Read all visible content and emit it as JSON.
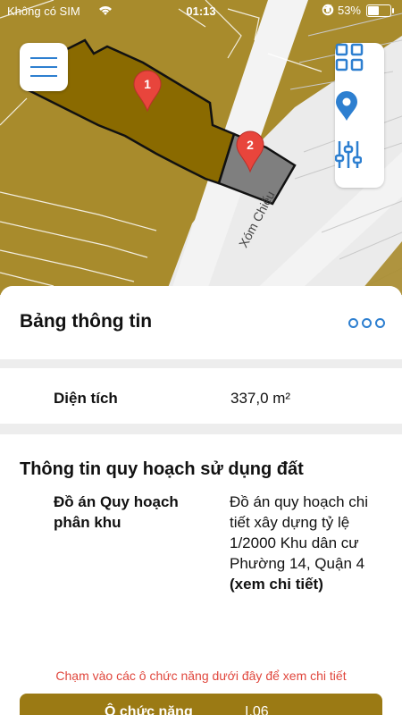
{
  "status_bar": {
    "carrier": "Không có SIM",
    "time": "01:13",
    "battery": "53%",
    "battery_level": 0.53
  },
  "map": {
    "street_name": "Xóm Chiếu",
    "markers": [
      "1",
      "2"
    ],
    "colors": {
      "land_zone": "#a88b2c",
      "selected_parcel": "#8a6a00",
      "adjacent_parcel": "#7f7f7f",
      "road": "#ececec",
      "marker": "#e8453c"
    },
    "controls": [
      "menu-icon",
      "grid-icon",
      "location-pin-icon",
      "sliders-icon"
    ]
  },
  "info_panel": {
    "title": "Bảng thông tin",
    "area": {
      "label": "Diện tích",
      "value": "337,0 m²"
    },
    "planning": {
      "title": "Thông tin quy hoạch sử dụng đất",
      "label": "Đồ án Quy hoạch phân khu",
      "value": "Đồ án quy hoạch chi tiết xây dựng tỷ lệ 1/2000 Khu dân cư Phường 14, Quận 4",
      "link": "(xem chi tiết)"
    },
    "hint": "Chạm vào các ô chức năng dưới đây để xem chi tiết",
    "function_table": {
      "label": "Ô chức năng",
      "value": "I.06"
    },
    "accent_color": "#2d7fd0",
    "hint_color": "#e0463c"
  }
}
